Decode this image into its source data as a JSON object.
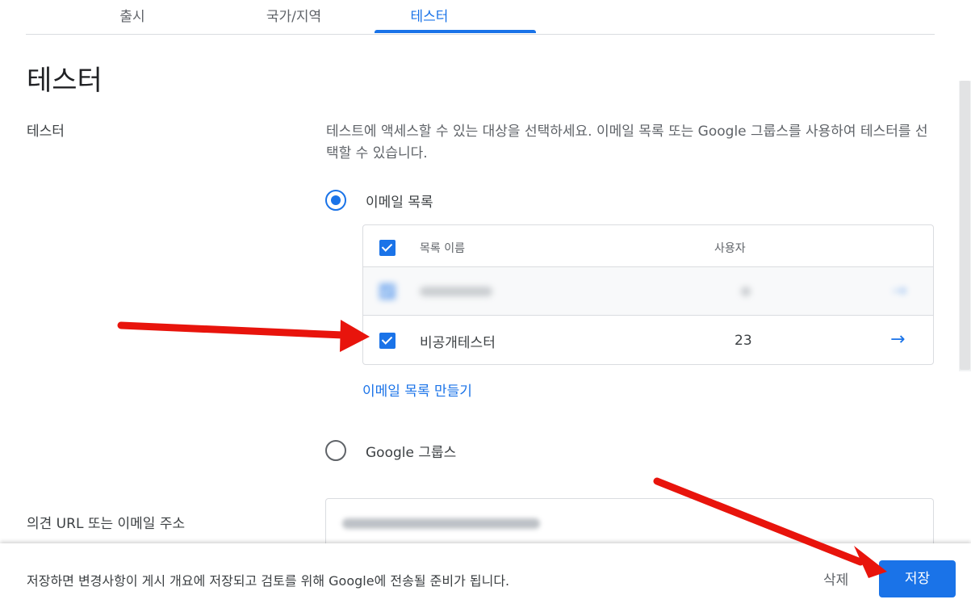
{
  "tabs": [
    {
      "label": "출시"
    },
    {
      "label": "국가/지역"
    },
    {
      "label": "테스터"
    }
  ],
  "page_title": "테스터",
  "section": {
    "label": "테스터",
    "description": "테스트에 액세스할 수 있는 대상을 선택하세요. 이메일 목록 또는 Google 그룹스를 사용하여 테스터를 선택할 수 있습니다."
  },
  "options": {
    "email_list": {
      "label": "이메일 목록",
      "selected": true
    },
    "google_groups": {
      "label": "Google 그룹스",
      "selected": false
    }
  },
  "email_lists": {
    "columns": {
      "name": "목록 이름",
      "users": "사용자"
    },
    "rows": [
      {
        "name": "",
        "users": "",
        "checked": true,
        "blurred": true
      },
      {
        "name": "비공개테스터",
        "users": "23",
        "checked": true,
        "blurred": false
      }
    ],
    "create_link": "이메일 목록 만들기"
  },
  "feedback": {
    "label": "의견 URL 또는 이메일 주소",
    "value": ""
  },
  "footer": {
    "message": "저장하면 변경사항이 게시 개요에 저장되고 검토를 위해 Google에 전송될 준비가 됩니다.",
    "delete_label": "삭제",
    "save_label": "저장"
  },
  "colors": {
    "accent": "#1a73e8",
    "annotation_arrow": "#e8140c",
    "text_secondary": "#5f6368"
  },
  "icons": {
    "row_action": "arrow-right-icon"
  }
}
